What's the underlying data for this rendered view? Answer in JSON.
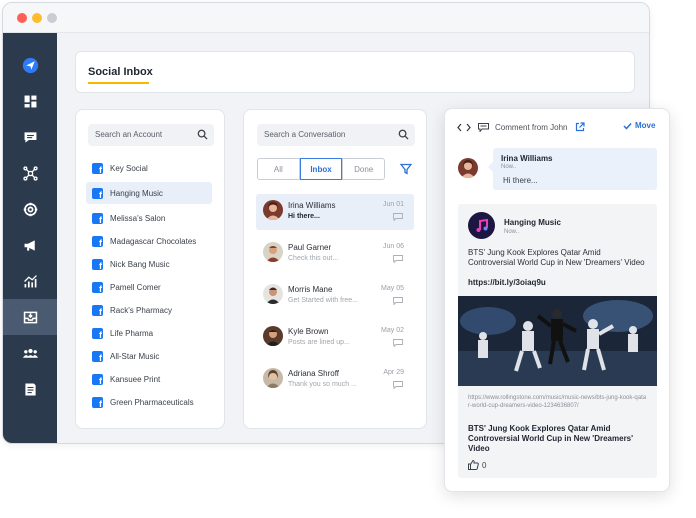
{
  "colors": {
    "sidebar": "#2c3a4d",
    "accent_blue": "#2d6fd6",
    "title_underline": "#f5b700",
    "facebook": "#1877f2"
  },
  "window_dots": [
    "#ff5f57",
    "#febc2e",
    "#c9ccd1"
  ],
  "sidebar": {
    "items": [
      {
        "icon": "paper-plane-icon",
        "active": false
      },
      {
        "icon": "dashboard-grid-icon",
        "active": false
      },
      {
        "icon": "chat-bubble-icon",
        "active": false
      },
      {
        "icon": "network-hub-icon",
        "active": false
      },
      {
        "icon": "life-ring-icon",
        "active": false
      },
      {
        "icon": "megaphone-icon",
        "active": false
      },
      {
        "icon": "analytics-chart-icon",
        "active": false
      },
      {
        "icon": "inbox-tray-icon",
        "active": true
      },
      {
        "icon": "users-group-icon",
        "active": false
      },
      {
        "icon": "document-list-icon",
        "active": false
      }
    ]
  },
  "header": {
    "title": "Social Inbox"
  },
  "accounts": {
    "search_placeholder": "Search an Account",
    "items": [
      {
        "label": "Key Social",
        "selected": false
      },
      {
        "label": "Hanging Music",
        "selected": true
      },
      {
        "label": "Melissa's Salon",
        "selected": false
      },
      {
        "label": "Madagascar Chocolates",
        "selected": false
      },
      {
        "label": "Nick Bang Music",
        "selected": false
      },
      {
        "label": "Pamell Comer",
        "selected": false
      },
      {
        "label": "Rack's Pharmacy",
        "selected": false
      },
      {
        "label": "Life Pharma",
        "selected": false
      },
      {
        "label": "All-Star Music",
        "selected": false
      },
      {
        "label": "Kansuee Print",
        "selected": false
      },
      {
        "label": "Green Pharmaceuticals",
        "selected": false
      }
    ]
  },
  "conversations": {
    "search_placeholder": "Search a Conversation",
    "tabs": [
      {
        "label": "All",
        "active": false
      },
      {
        "label": "Inbox",
        "active": true
      },
      {
        "label": "Done",
        "active": false
      }
    ],
    "items": [
      {
        "name": "Irina Williams",
        "preview": "Hi there...",
        "date": "Jun 01",
        "selected": true
      },
      {
        "name": "Paul Garner",
        "preview": "Check this out...",
        "date": "Jun 06",
        "selected": false
      },
      {
        "name": "Morris Mane",
        "preview": "Get Started with free...",
        "date": "May 05",
        "selected": false
      },
      {
        "name": "Kyle Brown",
        "preview": "Posts are lined up...",
        "date": "May 02",
        "selected": false
      },
      {
        "name": "Adriana Shroff",
        "preview": "Thank you so much ...",
        "date": "Apr 29",
        "selected": false
      }
    ]
  },
  "detail": {
    "header_text": "Comment from John",
    "move_label": "Move",
    "comment": {
      "author": "Irina Williams",
      "meta": "Now..",
      "text": "Hi there..."
    },
    "post": {
      "author": "Hanging Music",
      "meta": "Now..",
      "text": "BTS' Jung Kook Explores Qatar Amid Controversial World Cup in New 'Dreamers' Video",
      "link": "https://bit.ly/3oiaq9u",
      "url": "https://www.rollingstone.com/music/music-news/bts-jung-kook-qatar-world-cup-dreamers-video-1234636807/",
      "link_title": "BTS' Jung Kook Explores Qatar Amid Controversial World Cup in New 'Dreamers' Video",
      "like_count": "0"
    }
  }
}
